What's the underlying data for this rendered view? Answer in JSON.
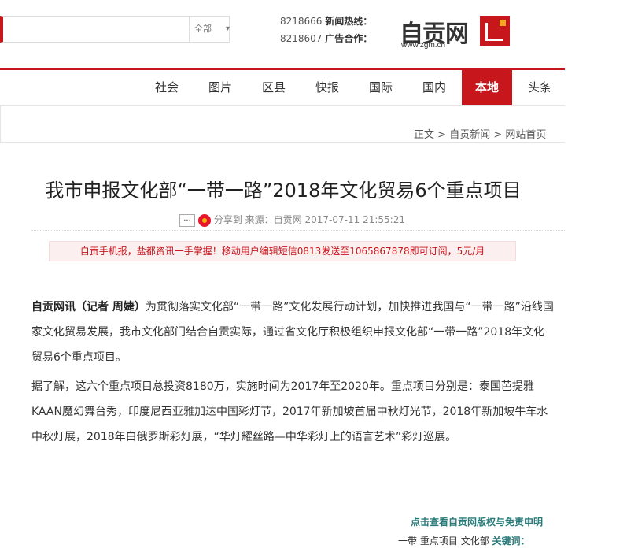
{
  "logo": {
    "text": "自贡网",
    "url": "www.zgm.cn"
  },
  "hotline": [
    {
      "label": "新闻热线：",
      "value": "8218666"
    },
    {
      "label": "广告合作：",
      "value": "8218607"
    }
  ],
  "search": {
    "select_label": "全部",
    "arrow": "▾"
  },
  "nav": [
    {
      "label": "头条",
      "active": false
    },
    {
      "label": "本地",
      "active": true
    },
    {
      "label": "国内",
      "active": false
    },
    {
      "label": "国际",
      "active": false
    },
    {
      "label": "快报",
      "active": false
    },
    {
      "label": "区县",
      "active": false
    },
    {
      "label": "图片",
      "active": false
    },
    {
      "label": "社会",
      "active": false
    }
  ],
  "breadcrumb": {
    "home": "网站首页",
    "sep": ">",
    "section": "自贡新闻",
    "current": "正文"
  },
  "article": {
    "title": "我市申报文化部“一带一路”2018年文化贸易6个重点项目",
    "date": "2017-07-11 21:55:21",
    "source": "来源：自贡网",
    "share_label": "分享到",
    "more_label": "..."
  },
  "promo": "自贡手机报，盐都资讯一手掌握！移动用户编辑短信0813发送至1065867878即可订阅，5元/月",
  "content": {
    "lead": "自贡网讯（记者 周婕）",
    "p1_rest": "为贯彻落实文化部“一带一路”文化发展行动计划，加快推进我国与“一带一路”沿线国家文化贸易发展，我市文化部门结合自贡实际，通过省文化厅积极组织申报文化部“一带一路”2018年文化贸易6个重点项目。",
    "p2": "据了解，这六个重点项目总投资8180万，实施时间为2017年至2020年。重点项目分别是：泰国芭提雅KAAN魔幻舞台秀，印度尼西亚雅加达中国彩灯节，2017年新加坡首届中秋灯光节，2018年新加坡牛车水中秋灯展，2018年白俄罗斯彩灯展，“华灯耀丝路—中华彩灯上的语言艺术”彩灯巡展。"
  },
  "footer": {
    "copyright_link": "点击查看自贡网版权与免责申明",
    "keywords_label": "关键词：",
    "keywords": [
      "文化部",
      "重点项目",
      "一带"
    ]
  },
  "icons": {
    "share": "weibo-icon"
  },
  "colors": {
    "brand_red": "#c8161d",
    "link_teal": "#2a7a7a"
  }
}
